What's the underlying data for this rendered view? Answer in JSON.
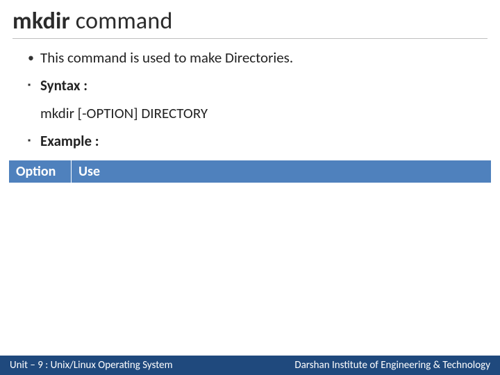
{
  "title": {
    "bold": "mkdir",
    "light": " command"
  },
  "bullets": {
    "desc": "This command is used to make Directories.",
    "syntax_label": "Syntax :",
    "syntax_text": "mkdir [-OPTION] DIRECTORY",
    "example_label": "Example :"
  },
  "table": {
    "headers": {
      "option": "Option",
      "use": "Use"
    }
  },
  "footer": {
    "left": "Unit – 9 : Unix/Linux Operating System",
    "right": "Darshan Institute of Engineering & Technology"
  }
}
